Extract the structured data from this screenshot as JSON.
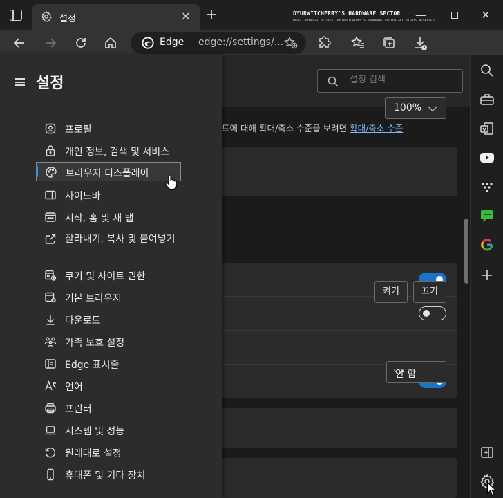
{
  "window": {
    "tab_title": "설정",
    "watermark_title": "DYURWITCHERRY'S HARDWARE SECTOR",
    "watermark_subtitle": "BLOG COPYRIGHT © 2015. DYURWITCHERRY'S HARDWARE SECTOR ALL RIGHTS RESERVED."
  },
  "address_bar": {
    "site_label": "Edge",
    "url": "edge://settings/..."
  },
  "settings": {
    "search_placeholder": "설정 검색",
    "zoom_value": "100%",
    "zoom_description": "트에 대해 확대/축소 수준을 보려면",
    "zoom_link": "확대/축소 수준",
    "button_on": "켜기",
    "button_off": "끄기",
    "select_value": "안 함",
    "toggles": [
      true,
      false,
      true
    ]
  },
  "menu": {
    "title": "설정",
    "items": [
      {
        "label": "프로필",
        "icon": "profile-icon"
      },
      {
        "label": "개인 정보, 검색 및 서비스",
        "icon": "lock-icon"
      },
      {
        "label": "브라우저 디스플레이",
        "icon": "palette-icon",
        "active": true
      },
      {
        "label": "사이드바",
        "icon": "sidebar-icon"
      },
      {
        "label": "시작, 홈 및 새 탭",
        "icon": "home-tab-icon"
      },
      {
        "label": "잘라내기, 복사 및 붙여넣기",
        "icon": "share-icon"
      },
      {
        "label": "쿠키 및 사이트 권한",
        "icon": "cookie-permissions-icon"
      },
      {
        "label": "기본 브라우저",
        "icon": "default-browser-icon"
      },
      {
        "label": "다운로드",
        "icon": "download-icon"
      },
      {
        "label": "가족 보호 설정",
        "icon": "family-icon"
      },
      {
        "label": "Edge 표시줄",
        "icon": "edge-bar-icon"
      },
      {
        "label": "언어",
        "icon": "language-icon"
      },
      {
        "label": "프린터",
        "icon": "printer-icon"
      },
      {
        "label": "시스템 및 성능",
        "icon": "laptop-icon"
      },
      {
        "label": "원래대로 설정",
        "icon": "reset-icon"
      },
      {
        "label": "휴대폰 및 기타 장치",
        "icon": "phone-icon"
      }
    ]
  },
  "colors": {
    "accent": "#1a72c9",
    "link": "#7ab8f2",
    "menu_bg": "#2c2c2c"
  }
}
